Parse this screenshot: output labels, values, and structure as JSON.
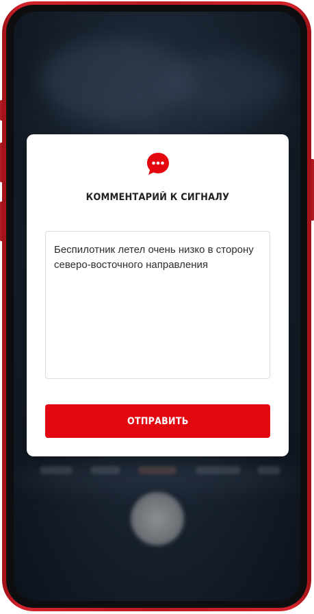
{
  "dialog": {
    "icon": "chat-bubble-icon",
    "title": "КОММЕНТАРИЙ К СИГНАЛУ",
    "comment": {
      "value": "Беспилотник летел очень низко в сторону северо-восточного направления",
      "placeholder": ""
    },
    "send_label": "ОТПРАВИТЬ"
  },
  "colors": {
    "accent": "#e3070f",
    "phone_frame": "#c41e25",
    "screen_background": "#1b2533"
  }
}
